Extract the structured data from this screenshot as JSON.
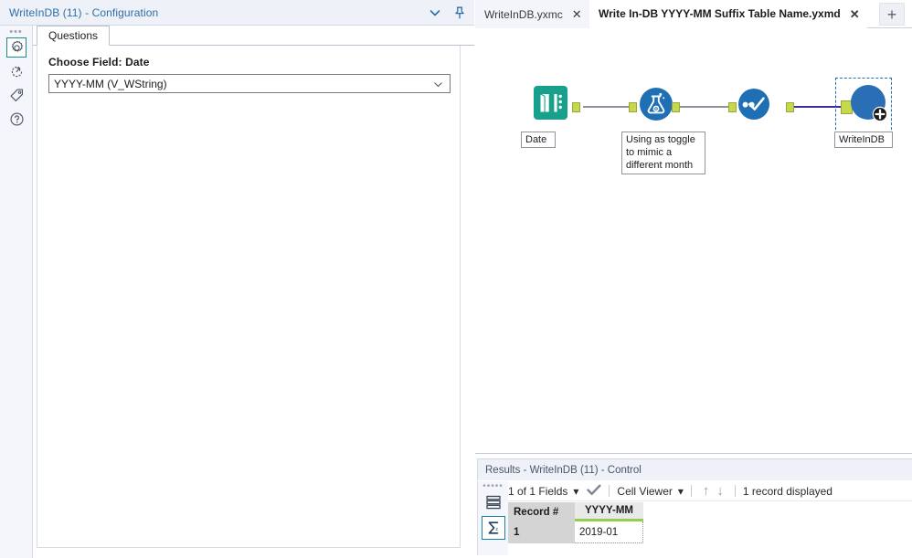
{
  "config_panel": {
    "header_title": "WriteInDB (11) - Configuration",
    "collapse_icon": "chevron-down-icon",
    "pin_icon": "pin-icon",
    "sidebar_items": [
      {
        "icon": "gear-icon",
        "name": "configuration",
        "active": true
      },
      {
        "icon": "runtime-arrow-icon",
        "name": "runtime",
        "active": false
      },
      {
        "icon": "tag-icon",
        "name": "annotation",
        "active": false
      },
      {
        "icon": "question-mark-icon",
        "name": "help",
        "active": false
      }
    ],
    "tab_label": "Questions",
    "field_label": "Choose Field: Date",
    "field_value": "YYYY-MM (V_WString)",
    "field_options": [
      "YYYY-MM (V_WString)"
    ]
  },
  "tabbar": {
    "tabs": [
      {
        "label": "WriteInDB.yxmc",
        "active": false
      },
      {
        "label": "Write In-DB YYYY-MM Suffix Table Name.yxmd",
        "active": true
      }
    ],
    "close_glyph": "✕",
    "add_tab_label": "+"
  },
  "canvas": {
    "nodes": [
      {
        "id": "date",
        "icon": "book-tool-icon",
        "label": "Date",
        "color": "#16a085",
        "selected": false
      },
      {
        "id": "formula",
        "icon": "flask-tool-icon",
        "label": "Using as toggle\nto mimic a\ndifferent month",
        "color": "#1f6fb4",
        "selected": false
      },
      {
        "id": "select",
        "icon": "select-tool-icon",
        "label": "",
        "color": "#1f6fb4",
        "selected": false
      },
      {
        "id": "writeindb",
        "icon": "macro-plus-tool-icon",
        "label": "WriteInDB",
        "color": "#2a6eb5",
        "selected": true
      }
    ],
    "connector_color": "#c6d84b",
    "line_color": "#8d939e",
    "selected_line_color": "#3b2f9e"
  },
  "results": {
    "title": "Results - WriteInDB (11) - Control",
    "sidebar_items": [
      {
        "icon": "messages-list-icon",
        "name": "messages",
        "active": false
      },
      {
        "icon": "sigma-icon",
        "name": "summary",
        "active": true
      }
    ],
    "toolbar": {
      "fields_label": "1 of 1 Fields",
      "fields_caret": "▾",
      "check_icon": "checkmark-icon",
      "viewer_label": "Cell Viewer",
      "viewer_caret": "▾",
      "up_arrow": "↑",
      "down_arrow": "↓",
      "record_count": "1 record displayed"
    },
    "grid": {
      "headers": [
        "Record #",
        "YYYY-MM"
      ],
      "rows": [
        [
          "1",
          "2019-01"
        ]
      ],
      "column_type_color": "#8fd14f"
    }
  }
}
